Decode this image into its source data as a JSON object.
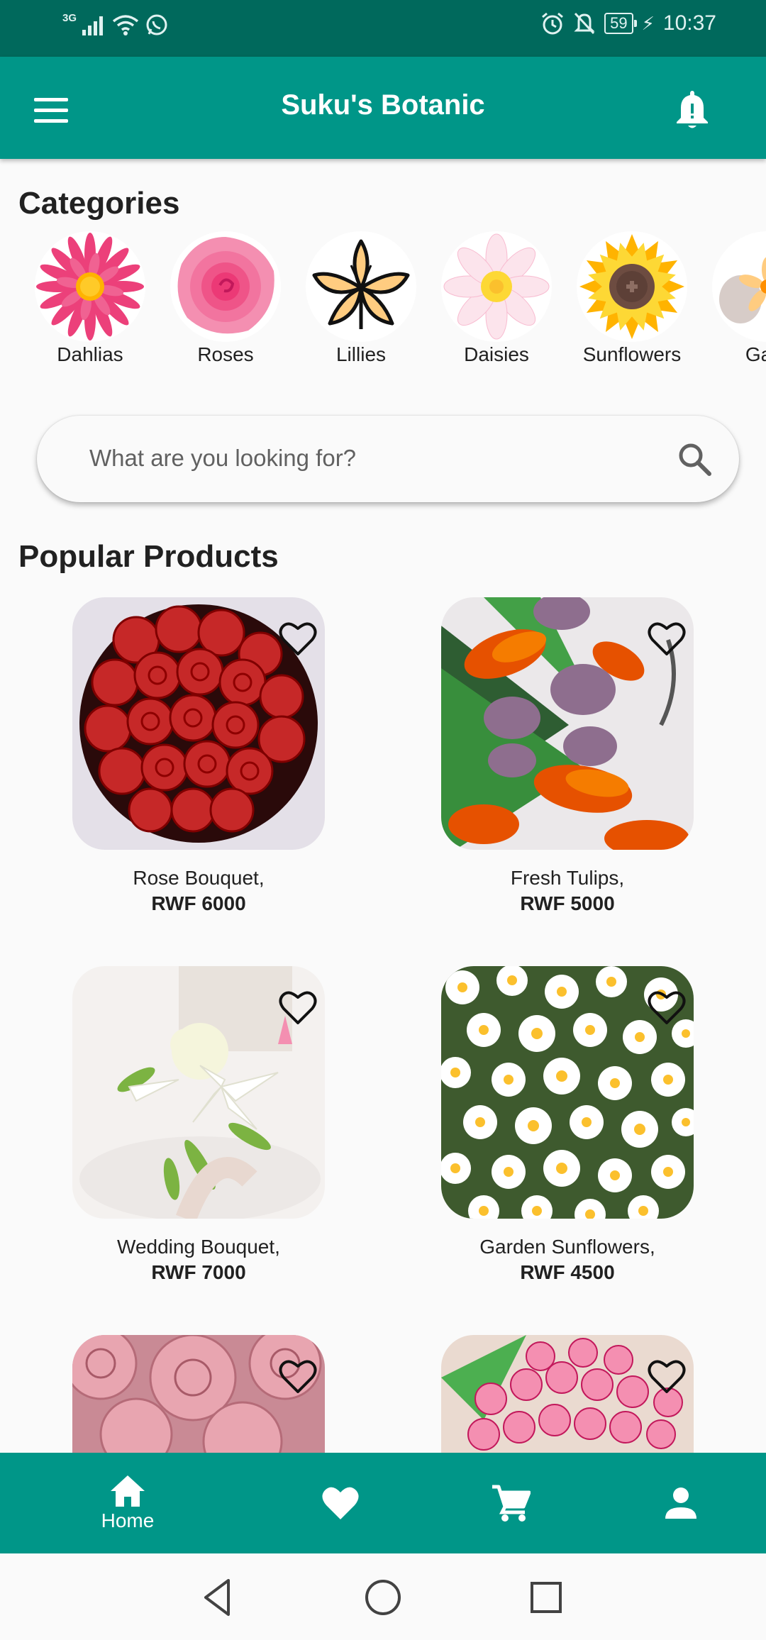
{
  "status_bar": {
    "network_type": "3G",
    "battery": "59",
    "time": "10:37"
  },
  "app_bar": {
    "title": "Suku's Botanic"
  },
  "categories_section": {
    "title": "Categories",
    "items": [
      {
        "label": "Dahlias",
        "icon": "dahlia-icon"
      },
      {
        "label": "Roses",
        "icon": "rose-icon"
      },
      {
        "label": "Lillies",
        "icon": "lily-icon"
      },
      {
        "label": "Daisies",
        "icon": "daisy-icon"
      },
      {
        "label": "Sunflowers",
        "icon": "sunflower-icon"
      },
      {
        "label": "Gard",
        "icon": "gardenia-icon"
      }
    ]
  },
  "search": {
    "placeholder": "What are you looking for?",
    "value": ""
  },
  "products_section": {
    "title": "Popular Products",
    "items": [
      {
        "name": "Rose Bouquet,",
        "price": "RWF 6000"
      },
      {
        "name": "Fresh Tulips,",
        "price": "RWF 5000"
      },
      {
        "name": "Wedding Bouquet,",
        "price": "RWF 7000"
      },
      {
        "name": "Garden Sunflowers,",
        "price": "RWF 4500"
      },
      {
        "name": "",
        "price": ""
      },
      {
        "name": "",
        "price": ""
      }
    ]
  },
  "bottom_nav": {
    "items": [
      {
        "label": "Home",
        "icon": "home-icon",
        "active": true
      },
      {
        "label": "",
        "icon": "heart-icon"
      },
      {
        "label": "",
        "icon": "cart-icon"
      },
      {
        "label": "",
        "icon": "person-icon"
      }
    ]
  },
  "colors": {
    "primary": "#009688",
    "primary_dark": "#00695c",
    "background": "#fafafa"
  }
}
